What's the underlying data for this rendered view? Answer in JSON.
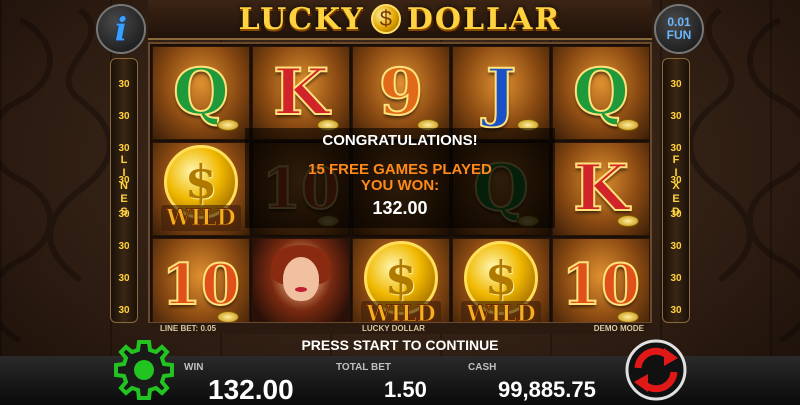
{
  "title": {
    "left": "LUCKY",
    "coin": "$",
    "right": "DOLLAR"
  },
  "info_button": {
    "label": "i"
  },
  "denomination": {
    "value": "0.01",
    "currency": "FUN"
  },
  "lines_panel": {
    "left_label": "LINES",
    "right_label": "FIXED",
    "left_numbers": [
      "30",
      "30",
      "30",
      "30",
      "30",
      "30",
      "30",
      "30"
    ],
    "right_numbers": [
      "30",
      "30",
      "30",
      "30",
      "30",
      "30",
      "30",
      "30"
    ]
  },
  "reels": [
    [
      {
        "symbol": "Q",
        "kind": "q"
      },
      {
        "symbol": "K",
        "kind": "k"
      },
      {
        "symbol": "9",
        "kind": "9"
      },
      {
        "symbol": "J",
        "kind": "j"
      },
      {
        "symbol": "Q",
        "kind": "q"
      }
    ],
    [
      {
        "symbol": "$",
        "kind": "wild",
        "label": "WILD"
      },
      {
        "symbol": "10",
        "kind": "10"
      },
      {
        "symbol": "",
        "kind": "blank"
      },
      {
        "symbol": "Q",
        "kind": "q"
      },
      {
        "symbol": "K",
        "kind": "k"
      }
    ],
    [
      {
        "symbol": "10",
        "kind": "10"
      },
      {
        "symbol": "",
        "kind": "lady"
      },
      {
        "symbol": "$",
        "kind": "wild",
        "label": "WILD"
      },
      {
        "symbol": "$",
        "kind": "wild",
        "label": "WILD"
      },
      {
        "symbol": "10",
        "kind": "10"
      }
    ]
  ],
  "message": {
    "congrats": "CONGRATULATIONS!",
    "played_line1": "15 FREE GAMES PLAYED",
    "played_line2": "YOU WON:",
    "amount": "132.00"
  },
  "footer": {
    "line_bet": "LINE BET: 0.05",
    "game_name": "LUCKY DOLLAR",
    "mode": "DEMO MODE",
    "press_start": "PRESS START TO CONTINUE"
  },
  "bottom": {
    "win_label": "WIN",
    "win_value": "132.00",
    "total_bet_label": "TOTAL BET",
    "total_bet_value": "1.50",
    "cash_label": "CASH",
    "cash_value": "99,885.75"
  },
  "colors": {
    "gold": "#ffd23f",
    "settings_green": "#22c422",
    "spin_red": "#e01818"
  },
  "icons": {
    "settings": "gear-icon",
    "spin": "spin-arrows-icon"
  }
}
